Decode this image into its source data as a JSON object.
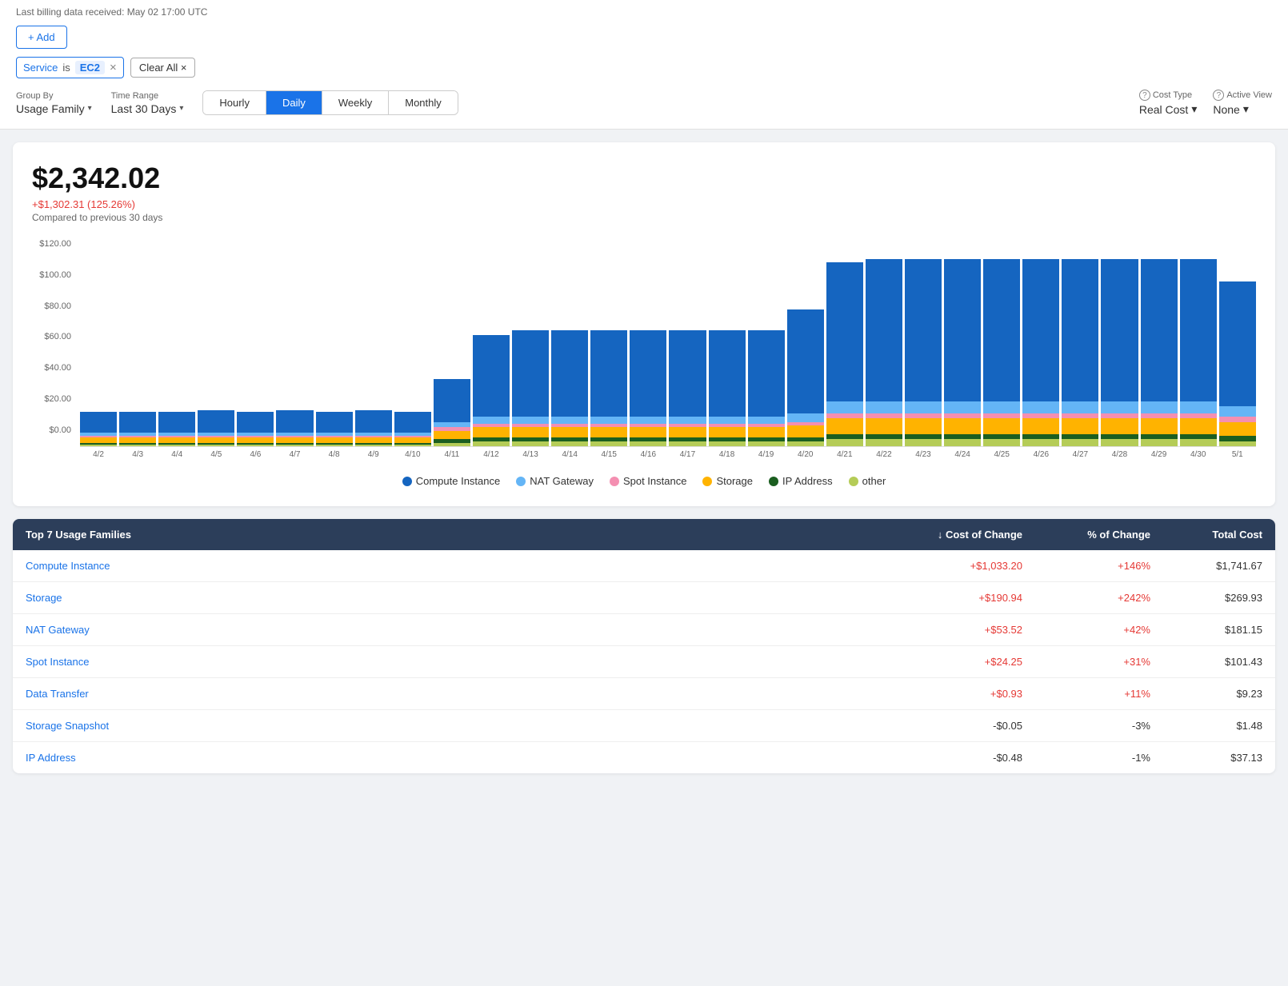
{
  "header": {
    "last_billing": "Last billing data received: May 02 17:00 UTC",
    "add_label": "+ Add",
    "filter": {
      "service_label": "Service",
      "op": "is",
      "value": "EC2",
      "close": "×"
    },
    "clear_all": "Clear All ×"
  },
  "controls": {
    "group_by_label": "Group By",
    "group_by_value": "Usage Family",
    "time_range_label": "Time Range",
    "time_range_value": "Last 30 Days",
    "granularity": {
      "options": [
        "Hourly",
        "Daily",
        "Weekly",
        "Monthly"
      ],
      "active": "Daily"
    },
    "cost_type_label": "Cost Type",
    "cost_type_value": "Real Cost",
    "active_view_label": "Active View",
    "active_view_value": "None"
  },
  "summary": {
    "total": "$2,342.02",
    "change": "+$1,302.31 (125.26%)",
    "compare_text": "Compared to previous 30 days"
  },
  "chart": {
    "y_labels": [
      "$0.00",
      "$20.00",
      "$40.00",
      "$60.00",
      "$80.00",
      "$100.00",
      "$120.00"
    ],
    "x_labels": [
      "4/2",
      "4/3",
      "4/4",
      "4/5",
      "4/6",
      "4/7",
      "4/8",
      "4/9",
      "4/10",
      "4/11",
      "4/12",
      "4/13",
      "4/14",
      "4/15",
      "4/16",
      "4/17",
      "4/18",
      "4/19",
      "4/20",
      "4/21",
      "4/22",
      "4/23",
      "4/24",
      "4/25",
      "4/26",
      "4/27",
      "4/28",
      "4/29",
      "4/30",
      "5/1"
    ],
    "bars": [
      {
        "compute": 12,
        "nat": 2,
        "spot": 1,
        "storage": 3,
        "ip": 1,
        "other": 1
      },
      {
        "compute": 12,
        "nat": 2,
        "spot": 1,
        "storage": 3,
        "ip": 1,
        "other": 1
      },
      {
        "compute": 12,
        "nat": 2,
        "spot": 1,
        "storage": 3,
        "ip": 1,
        "other": 1
      },
      {
        "compute": 13,
        "nat": 2,
        "spot": 1,
        "storage": 3,
        "ip": 1,
        "other": 1
      },
      {
        "compute": 12,
        "nat": 2,
        "spot": 1,
        "storage": 3,
        "ip": 1,
        "other": 1
      },
      {
        "compute": 13,
        "nat": 2,
        "spot": 1,
        "storage": 3,
        "ip": 1,
        "other": 1
      },
      {
        "compute": 12,
        "nat": 2,
        "spot": 1,
        "storage": 3,
        "ip": 1,
        "other": 1
      },
      {
        "compute": 13,
        "nat": 2,
        "spot": 1,
        "storage": 3,
        "ip": 1,
        "other": 1
      },
      {
        "compute": 12,
        "nat": 2,
        "spot": 1,
        "storage": 3,
        "ip": 1,
        "other": 1
      },
      {
        "compute": 25,
        "nat": 3,
        "spot": 2,
        "storage": 5,
        "ip": 2,
        "other": 2
      },
      {
        "compute": 47,
        "nat": 4,
        "spot": 2,
        "storage": 6,
        "ip": 2,
        "other": 3
      },
      {
        "compute": 50,
        "nat": 4,
        "spot": 2,
        "storage": 6,
        "ip": 2,
        "other": 3
      },
      {
        "compute": 50,
        "nat": 4,
        "spot": 2,
        "storage": 6,
        "ip": 2,
        "other": 3
      },
      {
        "compute": 50,
        "nat": 4,
        "spot": 2,
        "storage": 6,
        "ip": 2,
        "other": 3
      },
      {
        "compute": 50,
        "nat": 4,
        "spot": 2,
        "storage": 6,
        "ip": 2,
        "other": 3
      },
      {
        "compute": 50,
        "nat": 4,
        "spot": 2,
        "storage": 6,
        "ip": 2,
        "other": 3
      },
      {
        "compute": 50,
        "nat": 4,
        "spot": 2,
        "storage": 6,
        "ip": 2,
        "other": 3
      },
      {
        "compute": 50,
        "nat": 4,
        "spot": 2,
        "storage": 6,
        "ip": 2,
        "other": 3
      },
      {
        "compute": 60,
        "nat": 5,
        "spot": 2,
        "storage": 7,
        "ip": 2,
        "other": 3
      },
      {
        "compute": 80,
        "nat": 7,
        "spot": 3,
        "storage": 9,
        "ip": 3,
        "other": 4
      },
      {
        "compute": 82,
        "nat": 7,
        "spot": 3,
        "storage": 9,
        "ip": 3,
        "other": 4
      },
      {
        "compute": 82,
        "nat": 7,
        "spot": 3,
        "storage": 9,
        "ip": 3,
        "other": 4
      },
      {
        "compute": 82,
        "nat": 7,
        "spot": 3,
        "storage": 9,
        "ip": 3,
        "other": 4
      },
      {
        "compute": 82,
        "nat": 7,
        "spot": 3,
        "storage": 9,
        "ip": 3,
        "other": 4
      },
      {
        "compute": 82,
        "nat": 7,
        "spot": 3,
        "storage": 9,
        "ip": 3,
        "other": 4
      },
      {
        "compute": 82,
        "nat": 7,
        "spot": 3,
        "storage": 9,
        "ip": 3,
        "other": 4
      },
      {
        "compute": 82,
        "nat": 7,
        "spot": 3,
        "storage": 9,
        "ip": 3,
        "other": 4
      },
      {
        "compute": 82,
        "nat": 7,
        "spot": 3,
        "storage": 9,
        "ip": 3,
        "other": 4
      },
      {
        "compute": 82,
        "nat": 7,
        "spot": 3,
        "storage": 9,
        "ip": 3,
        "other": 4
      },
      {
        "compute": 72,
        "nat": 6,
        "spot": 3,
        "storage": 8,
        "ip": 3,
        "other": 3
      }
    ],
    "max_val": 120,
    "colors": {
      "compute": "#1565c0",
      "nat": "#64b5f6",
      "spot": "#f48fb1",
      "storage": "#ffb300",
      "ip": "#1b5e20",
      "other": "#b5cc57"
    },
    "legend": [
      {
        "label": "Compute Instance",
        "color": "#1565c0"
      },
      {
        "label": "NAT Gateway",
        "color": "#64b5f6"
      },
      {
        "label": "Spot Instance",
        "color": "#f48fb1"
      },
      {
        "label": "Storage",
        "color": "#ffb300"
      },
      {
        "label": "IP Address",
        "color": "#1b5e20"
      },
      {
        "label": "other",
        "color": "#b5cc57"
      }
    ]
  },
  "table": {
    "title": "Top 7 Usage Families",
    "col_change": "↓ Cost of Change",
    "col_pct": "% of Change",
    "col_total": "Total Cost",
    "rows": [
      {
        "name": "Compute Instance",
        "change": "+$1,033.20",
        "change_pos": true,
        "pct": "+146%",
        "pct_pos": true,
        "total": "$1,741.67"
      },
      {
        "name": "Storage",
        "change": "+$190.94",
        "change_pos": true,
        "pct": "+242%",
        "pct_pos": true,
        "total": "$269.93"
      },
      {
        "name": "NAT Gateway",
        "change": "+$53.52",
        "change_pos": true,
        "pct": "+42%",
        "pct_pos": true,
        "total": "$181.15"
      },
      {
        "name": "Spot Instance",
        "change": "+$24.25",
        "change_pos": true,
        "pct": "+31%",
        "pct_pos": true,
        "total": "$101.43"
      },
      {
        "name": "Data Transfer",
        "change": "+$0.93",
        "change_pos": true,
        "pct": "+11%",
        "pct_pos": true,
        "total": "$9.23"
      },
      {
        "name": "Storage Snapshot",
        "change": "-$0.05",
        "change_pos": false,
        "pct": "-3%",
        "pct_pos": false,
        "total": "$1.48"
      },
      {
        "name": "IP Address",
        "change": "-$0.48",
        "change_pos": false,
        "pct": "-1%",
        "pct_pos": false,
        "total": "$37.13"
      }
    ]
  }
}
